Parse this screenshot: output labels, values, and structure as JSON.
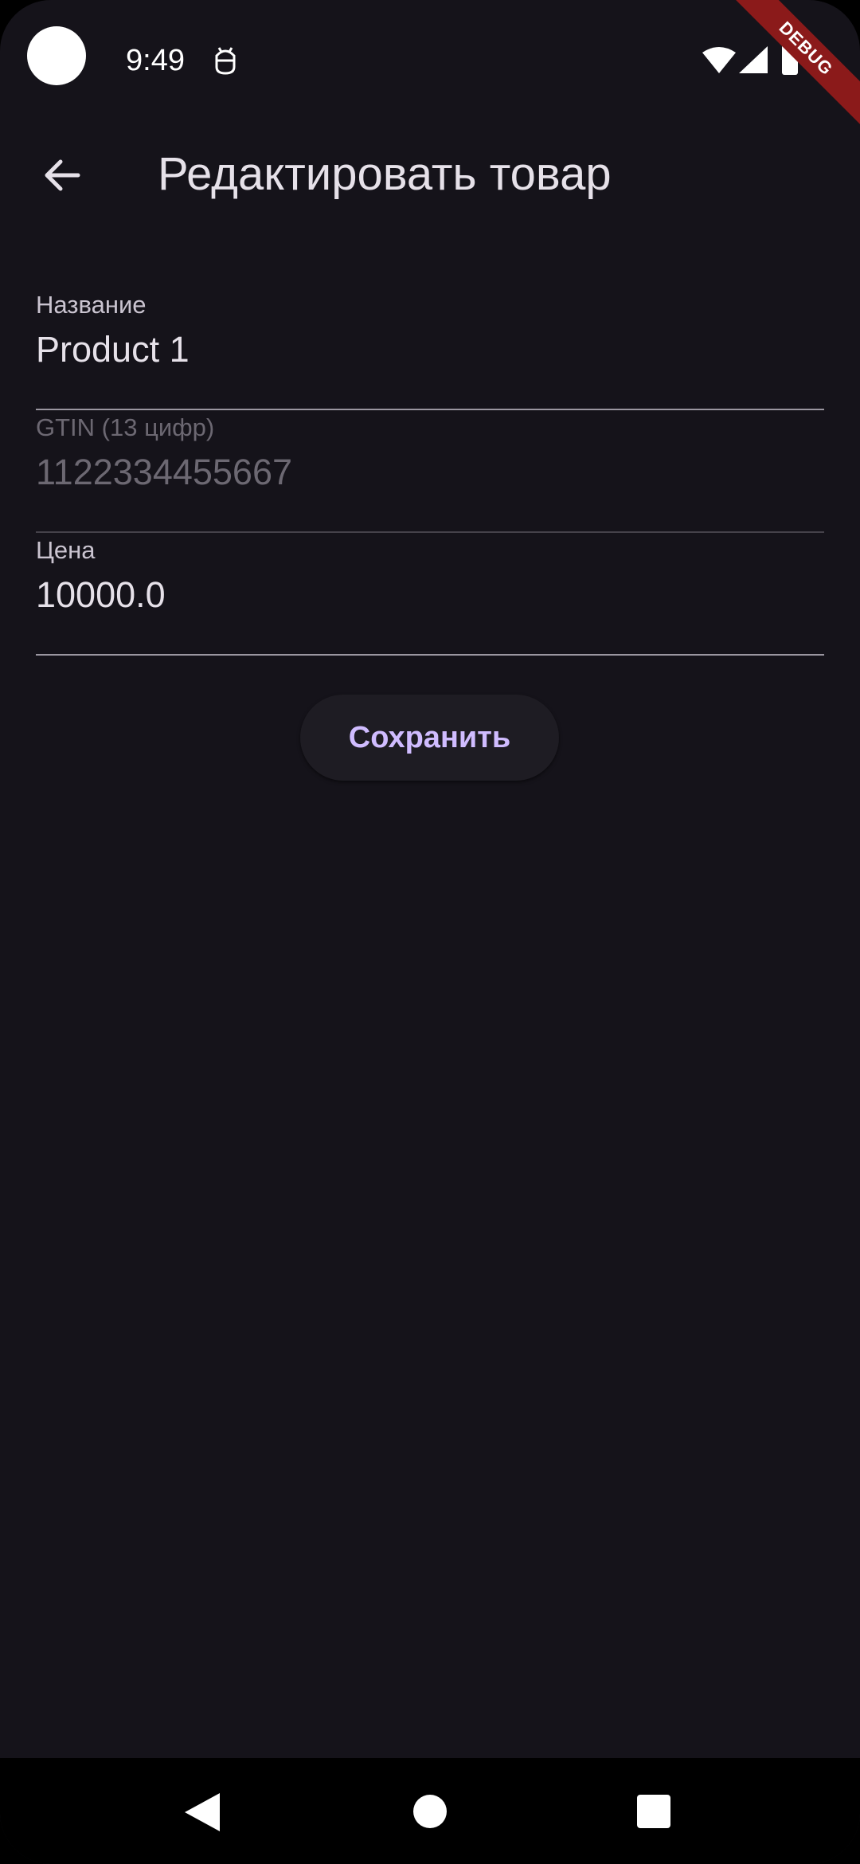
{
  "status_bar": {
    "time": "9:49",
    "debug_label": "DEBUG"
  },
  "app_bar": {
    "title": "Редактировать товар"
  },
  "form": {
    "name": {
      "label": "Название",
      "value": "Product 1"
    },
    "gtin": {
      "label": "GTIN (13 цифр)",
      "value": "1122334455667"
    },
    "price": {
      "label": "Цена",
      "value": "10000.0"
    },
    "save_label": "Сохранить"
  },
  "colors": {
    "background": "#15131a",
    "accent": "#d0bcff",
    "text_primary": "#e6e1e9",
    "debug_banner": "#8b1a1a"
  }
}
